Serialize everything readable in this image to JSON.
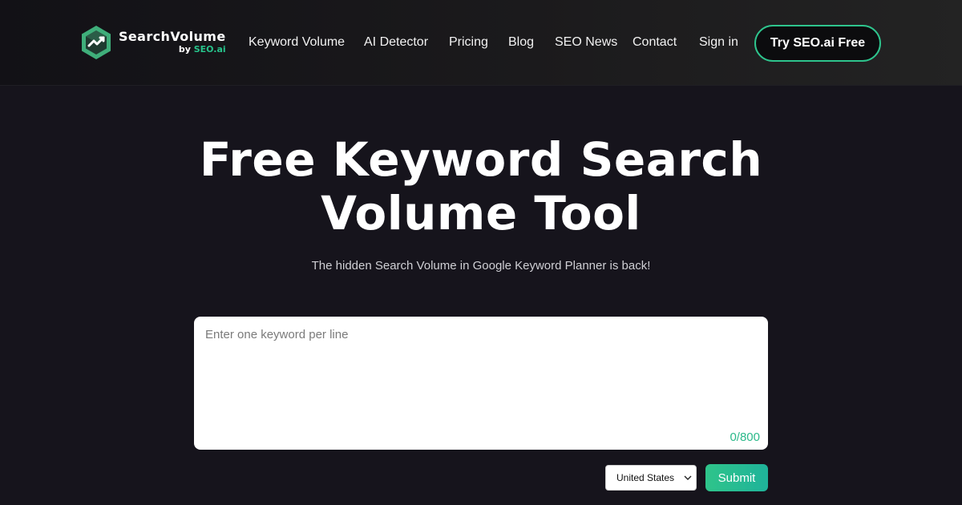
{
  "header": {
    "logo": {
      "name": "SearchVolume",
      "by_prefix": "by",
      "by_brand": "SEO.ai",
      "icon": "hexagon-logo-icon"
    },
    "nav": [
      {
        "label": "Keyword Volume"
      },
      {
        "label": "AI Detector"
      },
      {
        "label": "Pricing"
      },
      {
        "label": "Blog"
      },
      {
        "label": "SEO News"
      },
      {
        "label": "Contact"
      },
      {
        "label": "Sign in"
      }
    ],
    "cta_label": "Try SEO.ai Free"
  },
  "hero": {
    "title_line1": "Free Keyword Search",
    "title_line2": "Volume Tool",
    "subtitle": "The hidden Search Volume in Google Keyword Planner is back!"
  },
  "form": {
    "keywords_placeholder": "Enter one keyword per line",
    "keywords_value": "",
    "counter": "0/800",
    "country_selected": "United States",
    "submit_label": "Submit"
  },
  "colors": {
    "background": "#16141c",
    "accent": "#2ec48d",
    "counter": "#2bb98a"
  }
}
